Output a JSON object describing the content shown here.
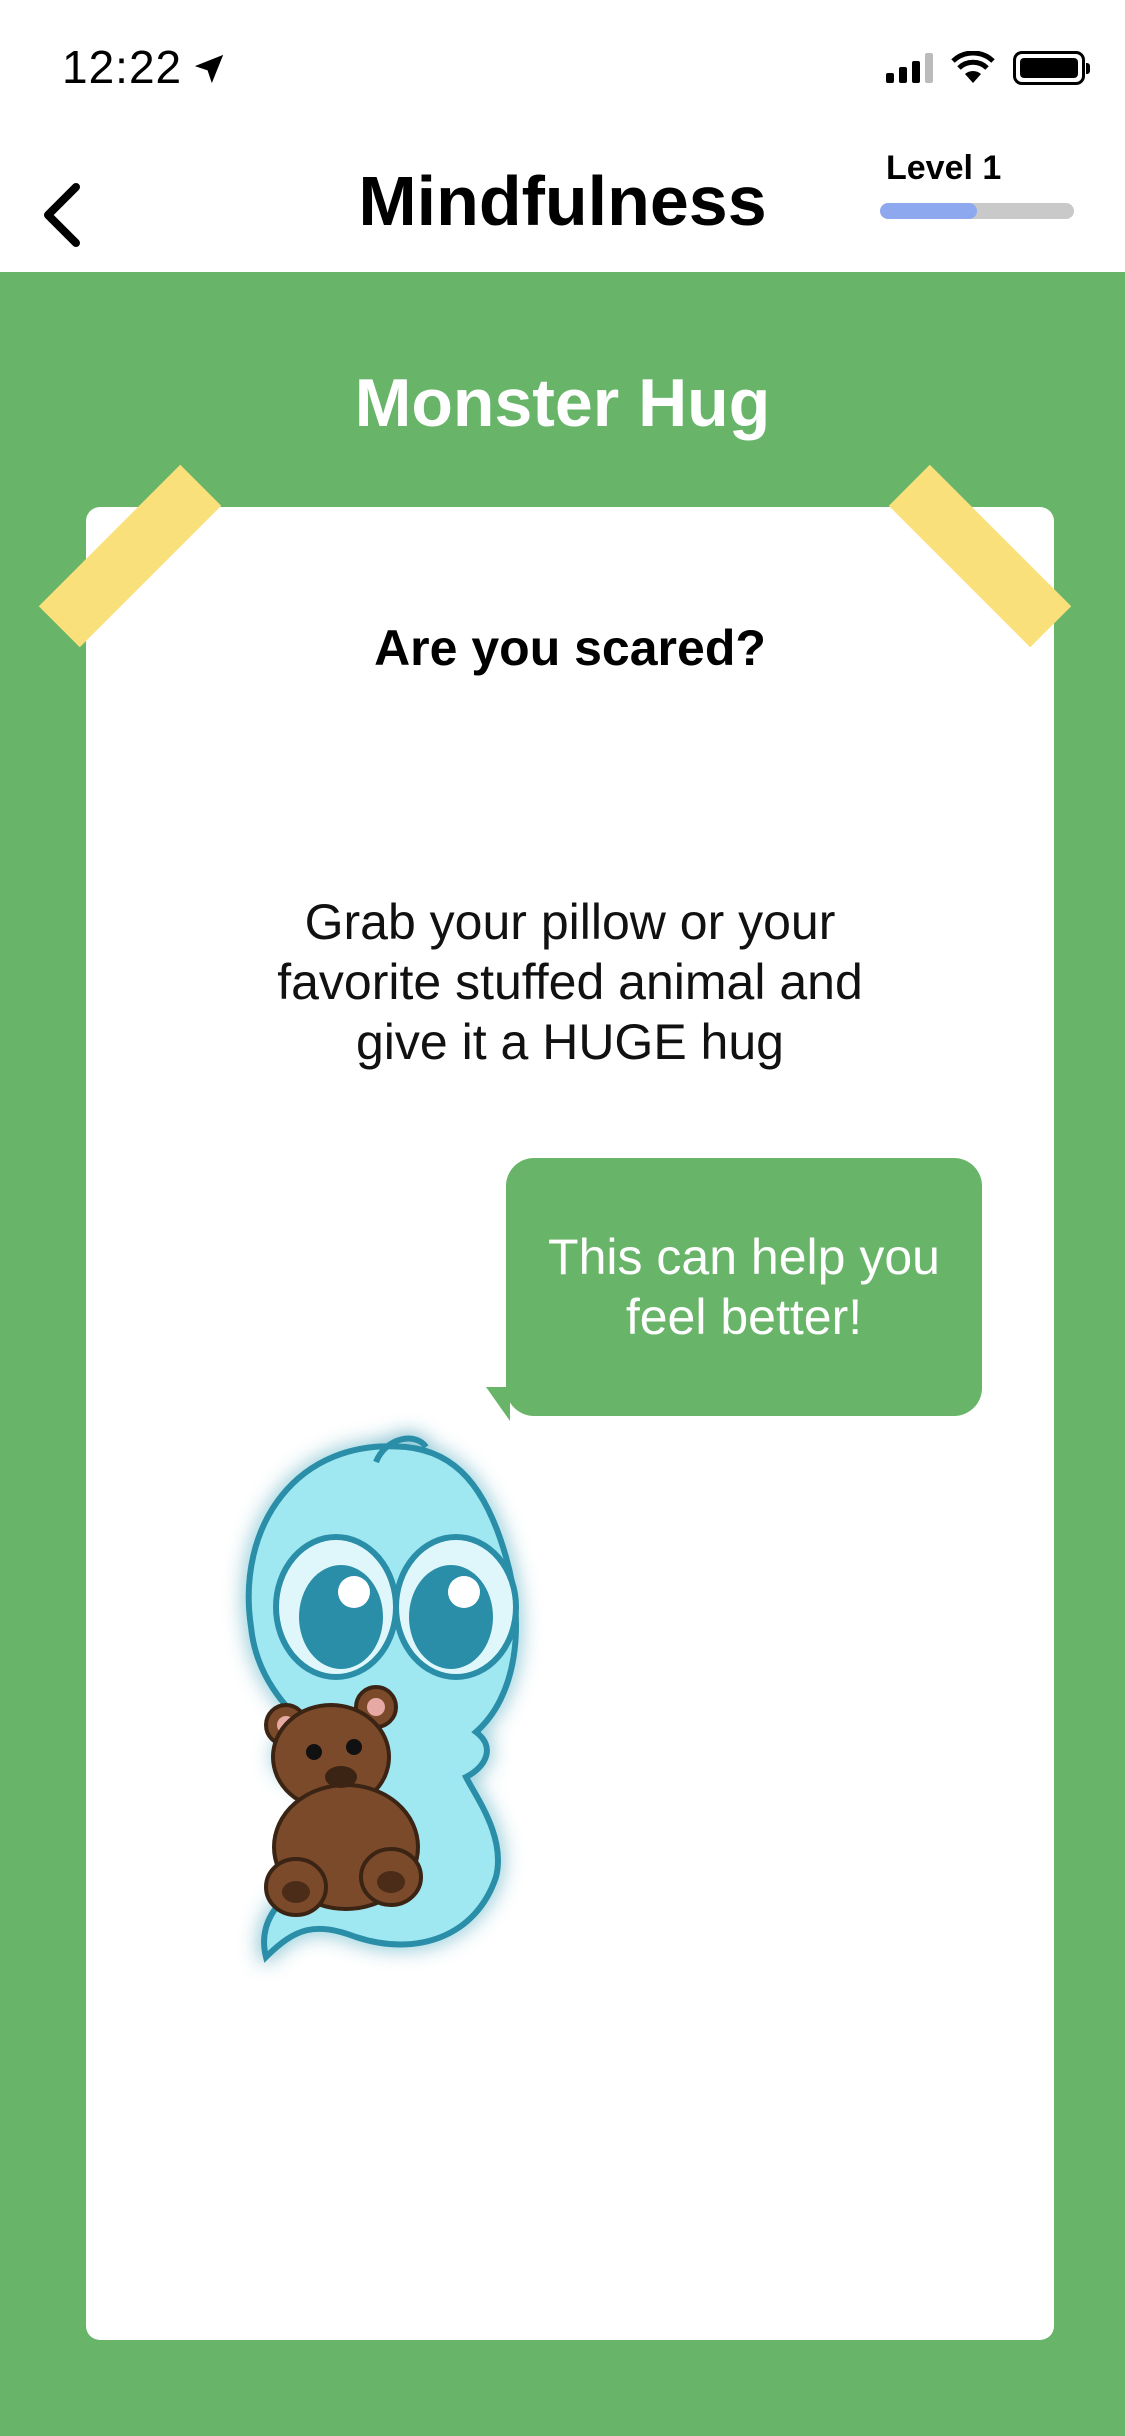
{
  "status_bar": {
    "time": "12:22"
  },
  "header": {
    "title": "Mindfulness",
    "level_label": "Level 1",
    "level_progress": 0.5
  },
  "activity": {
    "title": "Monster Hug",
    "question": "Are you scared?",
    "instructions": "Grab your pillow or your favorite stuffed animal and give it a HUGE hug",
    "speech": "This can help you feel better!"
  },
  "colors": {
    "background_green": "#68b569",
    "progress_fill": "#8ea8ef",
    "tape": "#f9e07a",
    "ghost": "#9fe8f2"
  },
  "icons": {
    "back": "chevron-left-icon",
    "location": "location-arrow-icon",
    "signal": "cellular-signal-icon",
    "wifi": "wifi-icon",
    "battery": "battery-icon"
  }
}
